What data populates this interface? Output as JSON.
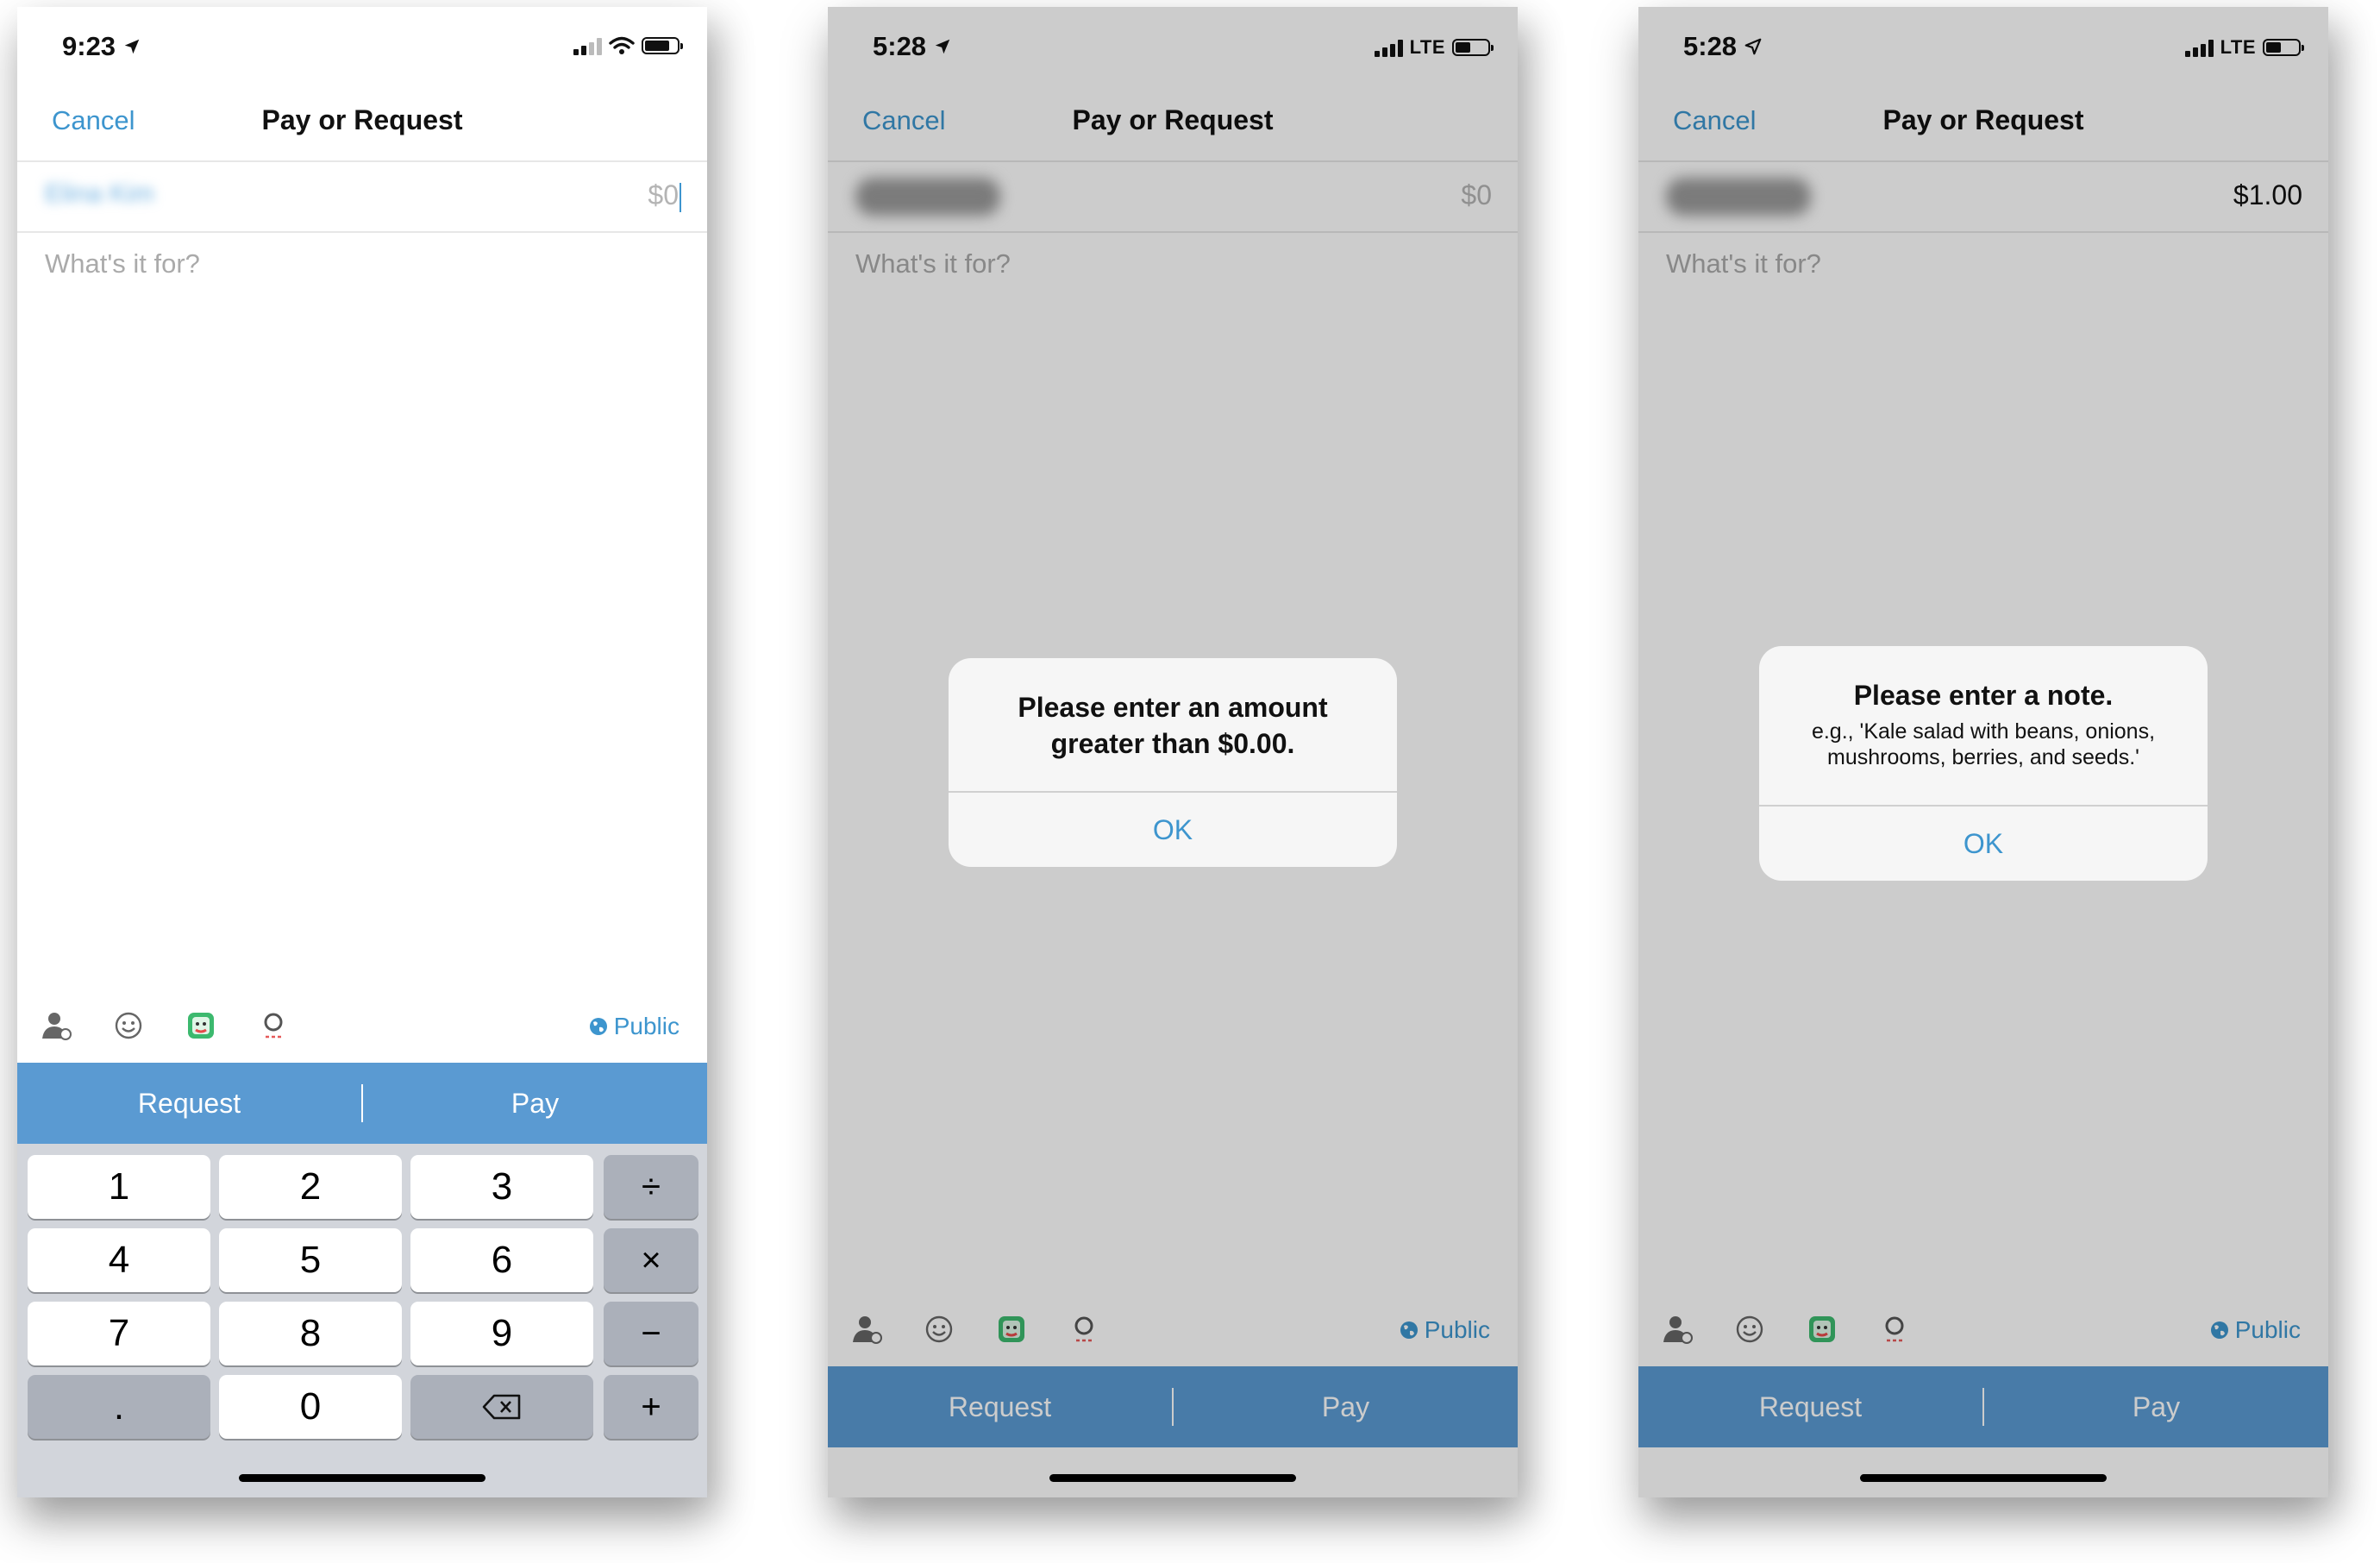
{
  "screens": [
    {
      "status": {
        "time": "9:23",
        "network": ""
      },
      "nav": {
        "cancel": "Cancel",
        "title": "Pay or Request"
      },
      "recipient": "Elina Kim",
      "amount": "$0",
      "note_placeholder": "What's it for?",
      "privacy": "Public",
      "actions": {
        "request": "Request",
        "pay": "Pay"
      },
      "keypad": {
        "keys": [
          "1",
          "2",
          "3",
          "4",
          "5",
          "6",
          "7",
          "8",
          "9",
          ".",
          "0"
        ],
        "operators": [
          "÷",
          "×",
          "−",
          "+"
        ]
      }
    },
    {
      "status": {
        "time": "5:28",
        "network": "LTE"
      },
      "nav": {
        "cancel": "Cancel",
        "title": "Pay or Request"
      },
      "amount": "$0",
      "note_placeholder": "What's it for?",
      "privacy": "Public",
      "actions": {
        "request": "Request",
        "pay": "Pay"
      },
      "alert": {
        "title": "Please enter an amount greater than $0.00.",
        "button": "OK"
      }
    },
    {
      "status": {
        "time": "5:28",
        "network": "LTE"
      },
      "nav": {
        "cancel": "Cancel",
        "title": "Pay or Request"
      },
      "amount": "$1.00",
      "note_placeholder": "What's it for?",
      "privacy": "Public",
      "actions": {
        "request": "Request",
        "pay": "Pay"
      },
      "alert": {
        "title": "Please enter a note.",
        "message": "e.g., 'Kale salad with beans, onions, mushrooms, berries, and seeds.'",
        "button": "OK"
      }
    }
  ],
  "icons": [
    "tag-person-icon",
    "emoji-icon",
    "sticker-icon",
    "gif-icon",
    "globe-icon",
    "backspace-icon",
    "location-arrow-icon"
  ],
  "colors": {
    "accent": "#3d95ce",
    "action_bar": "#5a9ad2",
    "keyboard_bg": "#d2d5db"
  }
}
